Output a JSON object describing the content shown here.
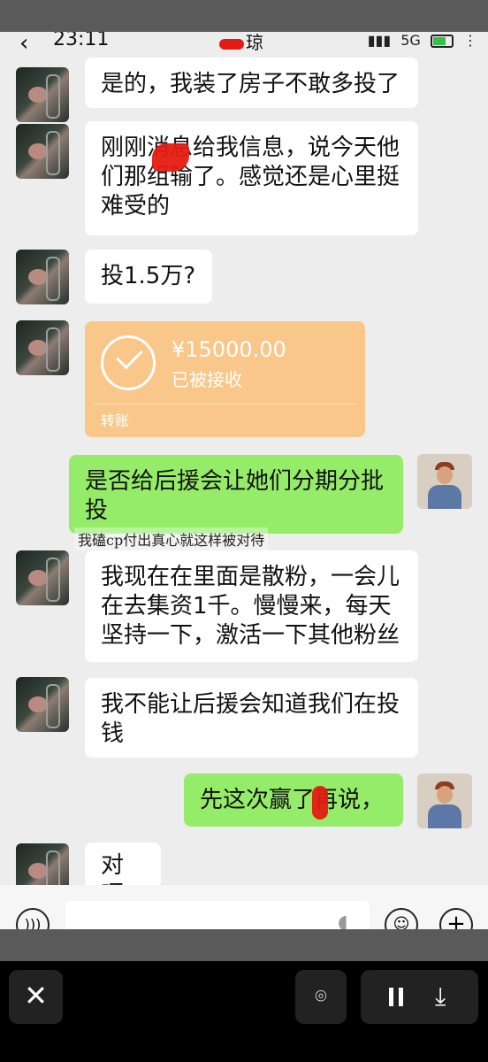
{
  "status_bar": {
    "time": "23:11",
    "signal": "5G",
    "chat_title_partial": "琼"
  },
  "messages": [
    {
      "from": "contact",
      "text": "是的，我装了房子不敢多投了"
    },
    {
      "from": "contact",
      "text": "刚刚消息给我信息，说今天他们那组输了。感觉还是心里挺难受的"
    },
    {
      "from": "contact",
      "text": "投1.5万?"
    },
    {
      "from": "contact",
      "type": "transfer",
      "amount": "¥15000.00",
      "status": "已被接收",
      "label": "转账"
    },
    {
      "from": "me",
      "text": "是否给后援会让她们分期分批投"
    },
    {
      "from": "contact",
      "text": "我现在在里面是散粉，一会儿在去集资1千。慢慢来，每天坚持一下，激活一下其他粉丝"
    },
    {
      "from": "contact",
      "text": "我不能让后援会知道我们在投钱"
    },
    {
      "from": "me",
      "text": "先这次赢了再说，"
    },
    {
      "from": "contact",
      "text": "对呀"
    }
  ],
  "annotation": "我磕cp付出真心就这样被对待",
  "icons": {
    "back": "back-icon",
    "voice": "voice-icon",
    "mic": "mic-icon",
    "emoji": "emoji-icon",
    "plus": "plus-icon",
    "close": "close-icon",
    "scan": "scan-icon",
    "pause": "pause-icon",
    "download": "download-icon"
  }
}
